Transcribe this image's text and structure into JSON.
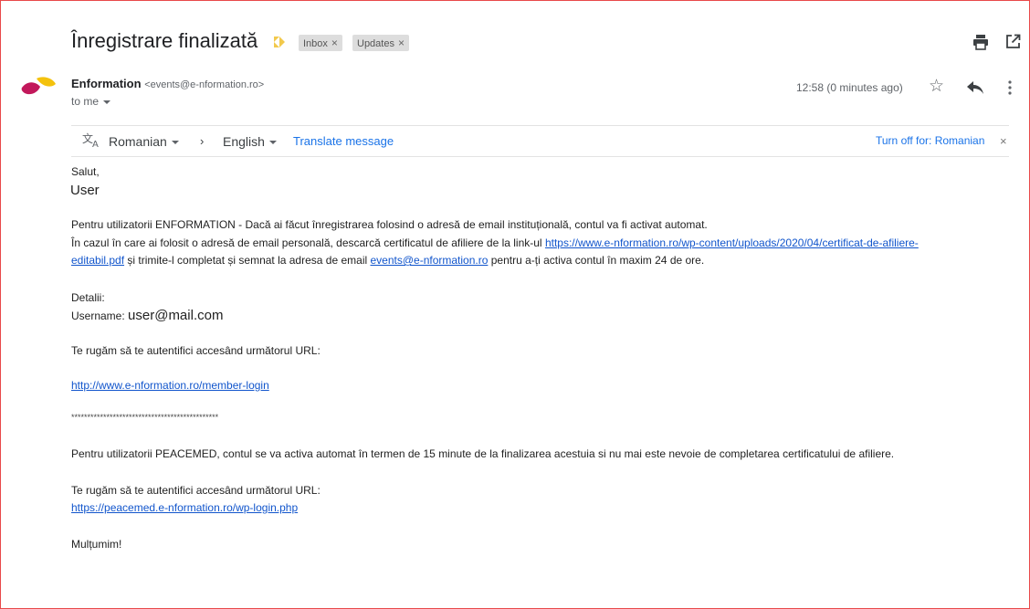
{
  "header": {
    "subject": "Înregistrare finalizată",
    "labels": [
      {
        "name": "Inbox",
        "remove": "×"
      },
      {
        "name": "Updates",
        "remove": "×"
      }
    ]
  },
  "sender": {
    "name": "Enformation",
    "email": "<events@e-nformation.ro>",
    "to": "to me",
    "time": "12:58 (0 minutes ago)",
    "star": "☆"
  },
  "translate_bar": {
    "from": "Romanian",
    "arrow": "›",
    "to": "English",
    "action": "Translate message",
    "turn_off": "Turn off for: Romanian",
    "close": "×"
  },
  "body": {
    "greeting": "Salut,",
    "user": "User",
    "p1_line1": "Pentru utilizatorii ENFORMATION - Dacă ai făcut înregistrarea folosind o adresă de email instituțională, contul va fi activat automat.",
    "p1_line2_prefix": "În cazul în care ai folosit o adresă de email personală, descarcă certificatul de afiliere de la link-ul ",
    "cert_link_a": "https://www.e-nformation.ro/wp-content/uploads/2020/04/certificat-de-afiliere-",
    "cert_link_b": "editabil.pdf",
    "p1_line3_mid": " și trimite-l completat și semnat la adresa de email ",
    "email_link": "events@e-nformation.ro",
    "p1_line3_suffix": " pentru a-ți activa contul în maxim 24 de ore.",
    "details_label": "Detalii:",
    "username_label": "Username: ",
    "username_value": "user@mail.com",
    "login_prompt": "Te rugăm să te autentifici accesând următorul URL:",
    "login_link": "http://www.e-nformation.ro/member-login",
    "separator": "**********************************************",
    "peacemed_text": "Pentru utilizatorii PEACEMED, contul se va activa automat în termen de 15 minute de la finalizarea acestuia si nu mai este nevoie de completarea certificatului de afiliere.",
    "login_prompt2": "Te rugăm să te autentifici accesând următorul URL:",
    "peacemed_link": "https://peacemed.e-nformation.ro/wp-login.php",
    "thanks": "Mulțumim!"
  }
}
